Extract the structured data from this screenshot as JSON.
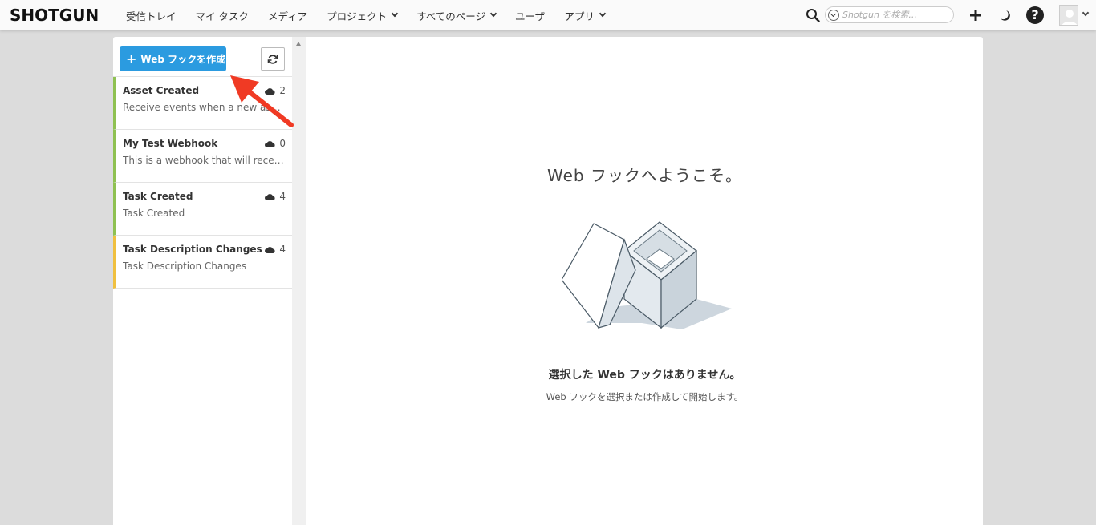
{
  "app": {
    "logo": "SHOTGUN"
  },
  "nav": {
    "items": [
      {
        "label": "受信トレイ",
        "dropdown": false
      },
      {
        "label": "マイ タスク",
        "dropdown": false
      },
      {
        "label": "メディア",
        "dropdown": false
      },
      {
        "label": "プロジェクト",
        "dropdown": true
      },
      {
        "label": "すべてのページ",
        "dropdown": true
      },
      {
        "label": "ユーザ",
        "dropdown": false
      },
      {
        "label": "アプリ",
        "dropdown": true
      }
    ]
  },
  "search": {
    "placeholder": "Shotgun を検索..."
  },
  "toolbar": {
    "create_label": "Web フックを作成",
    "icons": [
      "search-icon",
      "plus-icon",
      "moon-icon",
      "help-icon",
      "avatar"
    ]
  },
  "webhooks": [
    {
      "name": "Asset Created",
      "description": "Receive events when a new asset is created",
      "count": "2",
      "status_color": "#8fc152"
    },
    {
      "name": "My Test Webhook",
      "description": "This is a webhook that will receive events",
      "count": "0",
      "status_color": "#8fc152"
    },
    {
      "name": "Task Created",
      "description": "Task Created",
      "count": "4",
      "status_color": "#8fc152"
    },
    {
      "name": "Task Description Changes",
      "description": "Task Description Changes",
      "count": "4",
      "status_color": "#f0c040"
    }
  ],
  "main": {
    "welcome": "Web フックへようこそ。",
    "empty_title": "選択した Web フックはありません。",
    "empty_subtitle": "Web フックを選択または作成して開始します。"
  },
  "colors": {
    "accent": "#2b9be0",
    "annotation": "#f03a24"
  }
}
